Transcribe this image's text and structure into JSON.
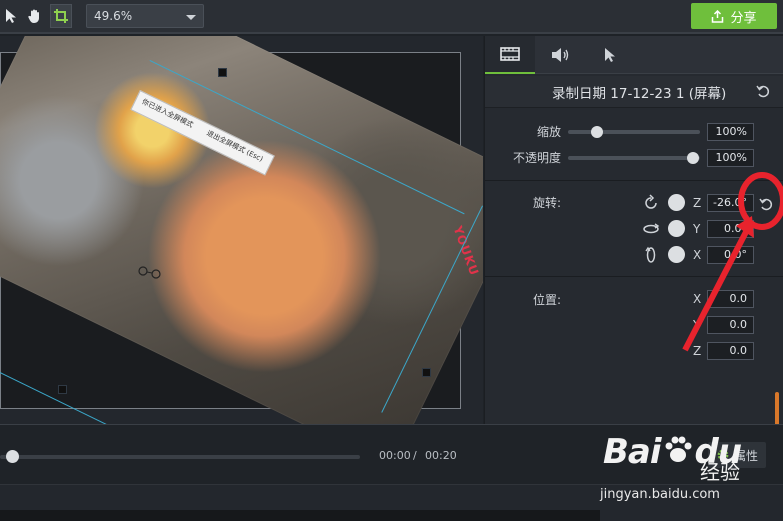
{
  "toolbar": {
    "tools": [
      "pointer-tool",
      "pan-tool",
      "crop-tool"
    ],
    "zoom_value": "49.6%",
    "share_label": "分享"
  },
  "canvas": {
    "caption_left": "你已进入全屏模式",
    "caption_right": "退出全屏模式 (Esc)",
    "watermark_text": "YOUKU"
  },
  "panel": {
    "tabs": [
      "video-tab",
      "audio-tab",
      "cursor-tab"
    ],
    "clip_title": "录制日期 17-12-23 1 (屏幕)",
    "scale": {
      "label": "缩放",
      "value": "100%",
      "level_percent": 100
    },
    "opacity": {
      "label": "不透明度",
      "value": "100%",
      "level_percent": 100
    },
    "rotation": {
      "label": "旋转:",
      "z": {
        "axis": "Z",
        "value": "-26.0°"
      },
      "y": {
        "axis": "Y",
        "value": "0.0°"
      },
      "x": {
        "axis": "X",
        "value": "0.0°"
      }
    },
    "position": {
      "label": "位置:",
      "x": {
        "axis": "X",
        "value": "0.0"
      },
      "y": {
        "axis": "Y",
        "value": "0.0"
      },
      "z": {
        "axis": "Z",
        "value": "0.0"
      }
    }
  },
  "timeline": {
    "current_time": "00:00",
    "separator": "/",
    "total_time": "00:20",
    "properties_label": "属性"
  },
  "overlay": {
    "logo_bai": "Bai",
    "logo_du": "du",
    "logo_suffix": "经验",
    "url": "jingyan.baidu.com"
  },
  "colors": {
    "accent_green": "#6fbf3c",
    "annotation_red": "#e8232d",
    "guide_blue": "#3ba7c9"
  }
}
